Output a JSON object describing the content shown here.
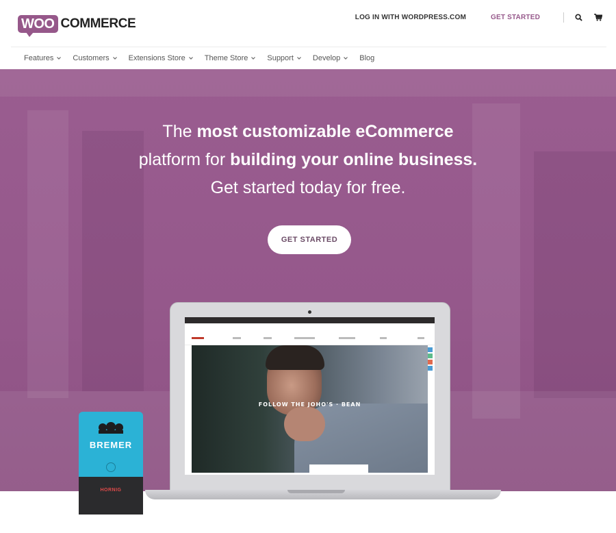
{
  "brand": {
    "woo": "WOO",
    "commerce": "COMMERCE",
    "accent": "#96588a"
  },
  "header": {
    "login_label": "LOG IN WITH WORDPRESS.COM",
    "get_started_label": "GET STARTED",
    "icons": [
      "search-icon",
      "cart-icon"
    ]
  },
  "nav": {
    "items": [
      {
        "label": "Features",
        "has_dropdown": true
      },
      {
        "label": "Customers",
        "has_dropdown": true
      },
      {
        "label": "Extensions Store",
        "has_dropdown": true
      },
      {
        "label": "Theme Store",
        "has_dropdown": true
      },
      {
        "label": "Support",
        "has_dropdown": true
      },
      {
        "label": "Develop",
        "has_dropdown": true
      },
      {
        "label": "Blog",
        "has_dropdown": false
      }
    ]
  },
  "hero": {
    "line1_pre": "The ",
    "line1_bold": "most customizable eCommerce",
    "line2_pre": "platform for ",
    "line2_bold": "building your online business.",
    "line3": "Get started today for free.",
    "cta_label": "GET STARTED",
    "background_color": "#96588a"
  },
  "laptop_screen": {
    "caption": "FOLLOW THE JOHO'S · BEAN"
  },
  "product": {
    "bag_label": "BREMER",
    "bag_sub": "HORNIG"
  }
}
